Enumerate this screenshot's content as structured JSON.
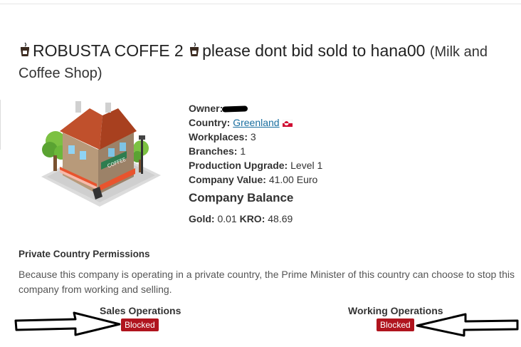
{
  "company": {
    "title_main": "ROBUSTA COFFE 2",
    "title_rest": "please dont bid sold to hana00",
    "type": "(Milk and Coffee Shop)",
    "owner_label": "Owner:",
    "country_label": "Country:",
    "country_value": "Greenland",
    "workplaces_label": "Workplaces:",
    "workplaces_value": "3",
    "branches_label": "Branches:",
    "branches_value": "1",
    "upgrade_label": "Production Upgrade:",
    "upgrade_value": "Level 1",
    "value_label": "Company Value:",
    "value_value": "41.00 Euro"
  },
  "balance": {
    "title": "Company Balance",
    "gold_label": "Gold:",
    "gold_value": "0.01",
    "kro_label": "KRO:",
    "kro_value": "48.69"
  },
  "permissions": {
    "title": "Private Country Permissions",
    "text": "Because this company is operating in a private country, the Prime Minister of this country can choose to stop this company from working and selling.",
    "sales_label": "Sales Operations",
    "sales_status": "Blocked",
    "working_label": "Working Operations",
    "working_status": "Blocked"
  },
  "colors": {
    "blocked": "#b0141e",
    "link": "#1a6fa0"
  },
  "icons": [
    "coffee-cup-icon",
    "greenland-flag-icon",
    "company-building-logo",
    "arrow-right-icon",
    "arrow-left-icon"
  ]
}
